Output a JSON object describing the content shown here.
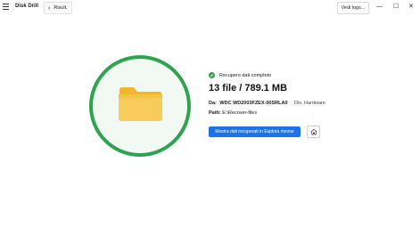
{
  "app": {
    "title": "Disk Drill"
  },
  "toolbar": {
    "back_label": "Risult.",
    "logs_label": "Vedi logs..."
  },
  "window_controls": {
    "minimize": "—",
    "maximize": "☐",
    "close": "✕"
  },
  "result": {
    "status": "Recupero dati completo",
    "summary": "13 file / 789.1 MB",
    "from_label": "Da:",
    "device": "WDC WD2003FZEX-00SRLA0",
    "device_type": "Dis. Hardware",
    "path_label": "Path:",
    "path": "E:\\Recover-files",
    "explorer_button": "Mostra dati recuperati in Esplora risorse"
  },
  "icons": {
    "menu": "hamburger-icon",
    "back": "chevron-left-icon",
    "status": "check-circle-icon",
    "folder": "folder-icon",
    "home": "home-icon"
  },
  "colors": {
    "accent": "#1a73e8",
    "success": "#2ea44f",
    "folder": "#f5c542"
  }
}
